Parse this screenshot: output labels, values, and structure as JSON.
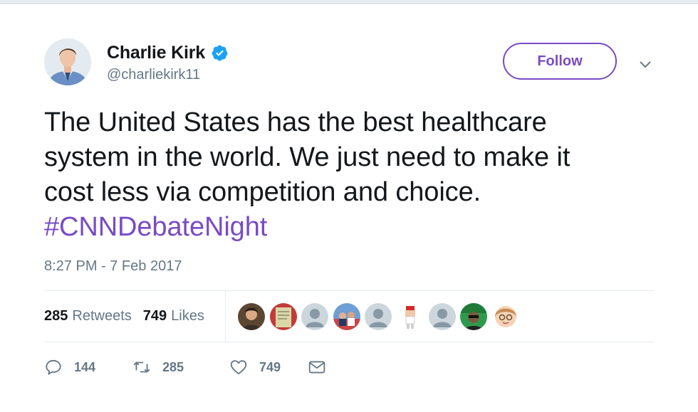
{
  "user": {
    "display_name": "Charlie Kirk",
    "handle": "@charliekirk11",
    "verified": true
  },
  "follow_button_label": "Follow",
  "tweet": {
    "text_lines": [
      "The United States has the best healthcare",
      "system in the world. We just need to make it",
      "cost less via competition and choice."
    ],
    "hashtag": "#CNNDebateNight",
    "timestamp": "8:27 PM - 7 Feb 2017"
  },
  "stats": {
    "retweets_count": "285",
    "retweets_label": "Retweets",
    "likes_count": "749",
    "likes_label": "Likes"
  },
  "actions": {
    "reply_count": "144",
    "retweet_count": "285",
    "like_count": "749"
  },
  "icons": {
    "verified": "verified-badge-icon",
    "caret": "chevron-down-icon",
    "reply": "reply-icon",
    "retweet": "retweet-icon",
    "like": "heart-icon",
    "dm": "envelope-icon"
  },
  "colors": {
    "accent": "#794bc4",
    "verified": "#1da1f2",
    "secondary_text": "#657786",
    "primary_text": "#14171a",
    "divider": "#e6ecf0"
  }
}
